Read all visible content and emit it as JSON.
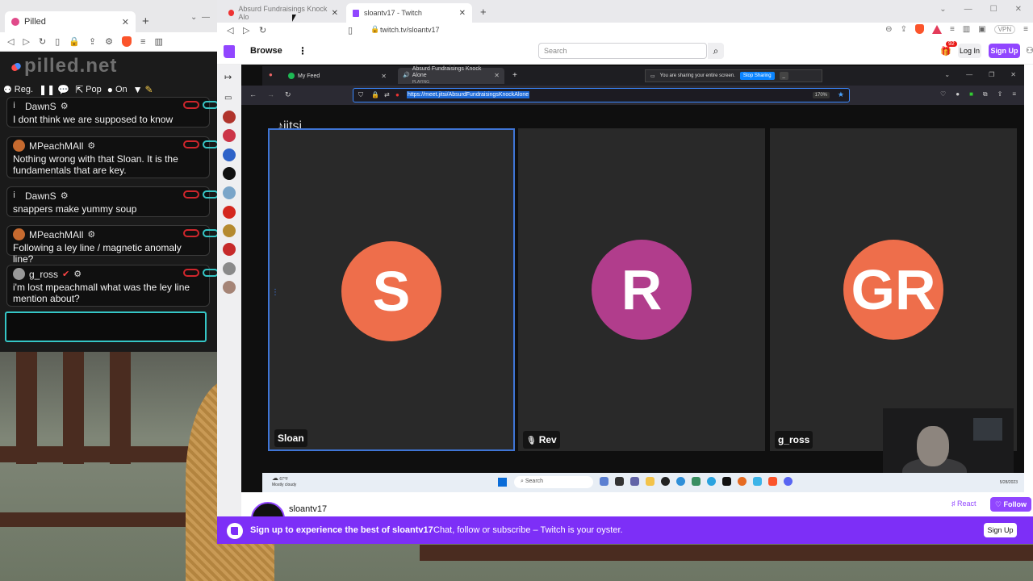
{
  "left_browser": {
    "tab_title": "Pilled",
    "logo_text": "pilled.net",
    "tools": {
      "reg": "Reg.",
      "pop": "Pop",
      "on": "On"
    },
    "messages": [
      {
        "user": "DawnS",
        "text": "I dont think we are supposed to know"
      },
      {
        "user": "MPeachMAll",
        "text": "Nothing wrong with that Sloan. It is the fundamentals that are key."
      },
      {
        "user": "DawnS",
        "text": "snappers make yummy soup"
      },
      {
        "user": "MPeachMAll",
        "text": "Following a ley line / magnetic anomaly line?"
      },
      {
        "user": "g_ross",
        "text": "i'm lost mpeachmall what was the ley line mention about?"
      }
    ]
  },
  "right_browser": {
    "tabs": [
      {
        "title": "Absurd Fundraisings Knock Alo"
      },
      {
        "title": "sloantv17 - Twitch"
      }
    ],
    "url": "twitch.tv/sloantv17",
    "vpn": "VPN"
  },
  "twitch": {
    "browse": "Browse",
    "search_placeholder": "Search",
    "notif_count": "92",
    "login": "Log In",
    "signup": "Sign Up",
    "channel_name": "sloantv17",
    "react": "React",
    "follow": "Follow",
    "banner_title": "Sign up to experience the best of sloantv17",
    "banner_sub": "Chat, follow or subscribe – Twitch is your oyster.",
    "banner_btn": "Sign Up"
  },
  "shared_screen": {
    "tab1": "My Feed",
    "tab2": "Absurd Fundraisings Knock Alone",
    "tab2_sub": "PLAYING",
    "share_msg": "You are sharing your entire screen.",
    "stop_sharing": "Stop Sharing",
    "hide": "_",
    "url": "https://meet.jitsi/AbsurdFundraisingsKnockAlone",
    "zoom": "170%",
    "jitsi_logo": "jitsi",
    "participants": [
      {
        "initials": "S",
        "name": "Sloan",
        "color": "#ee6e4b"
      },
      {
        "initials": "R",
        "name": "Rev",
        "color": "#b13d8c"
      },
      {
        "initials": "GR",
        "name": "g_ross",
        "color": "#ee6e4b"
      }
    ],
    "taskbar": {
      "temp": "67°F",
      "weather": "Mostly cloudy",
      "search": "Search",
      "date": "5/28/2023"
    }
  }
}
